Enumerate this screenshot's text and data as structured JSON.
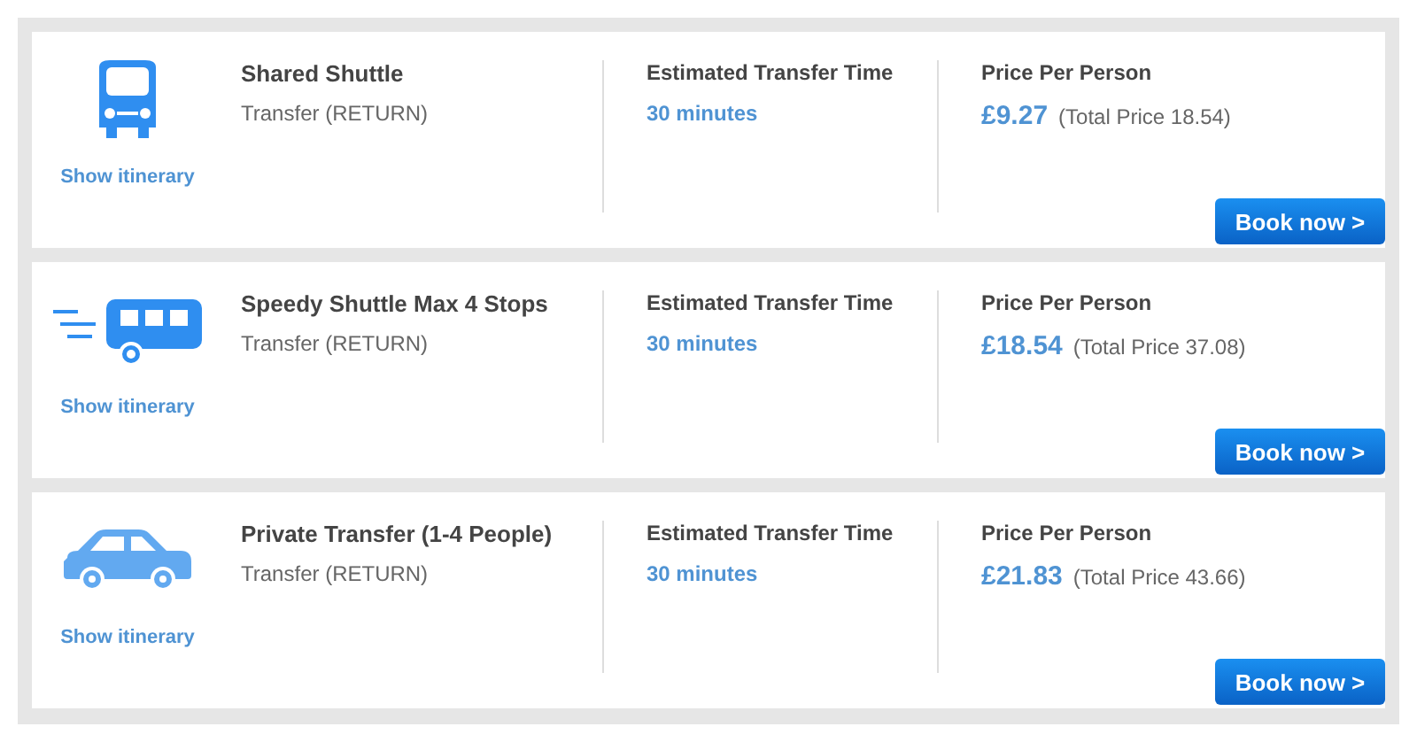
{
  "transfers": [
    {
      "kind": "bus",
      "link": "Show itinerary",
      "name": "Shared Shuttle",
      "type": "Transfer (RETURN)",
      "time_label": "Estimated Transfer Time",
      "time": "30 minutes",
      "price_label": "Price Per Person",
      "price": "£9.27",
      "total": "(Total Price 18.54)",
      "button": "Book now >"
    },
    {
      "kind": "van",
      "link": "Show itinerary",
      "name": "Speedy Shuttle Max 4 Stops",
      "type": "Transfer (RETURN)",
      "time_label": "Estimated Transfer Time",
      "time": "30 minutes",
      "price_label": "Price Per Person",
      "price": "£18.54",
      "total": "(Total Price 37.08)",
      "button": "Book now >"
    },
    {
      "kind": "car",
      "link": "Show itinerary",
      "name": "Private Transfer (1-4 People)",
      "type": "Transfer (RETURN)",
      "time_label": "Estimated Transfer Time",
      "time": "30 minutes",
      "price_label": "Price Per Person",
      "price": "£21.83",
      "total": "(Total Price 43.66)",
      "button": "Book now >"
    }
  ]
}
